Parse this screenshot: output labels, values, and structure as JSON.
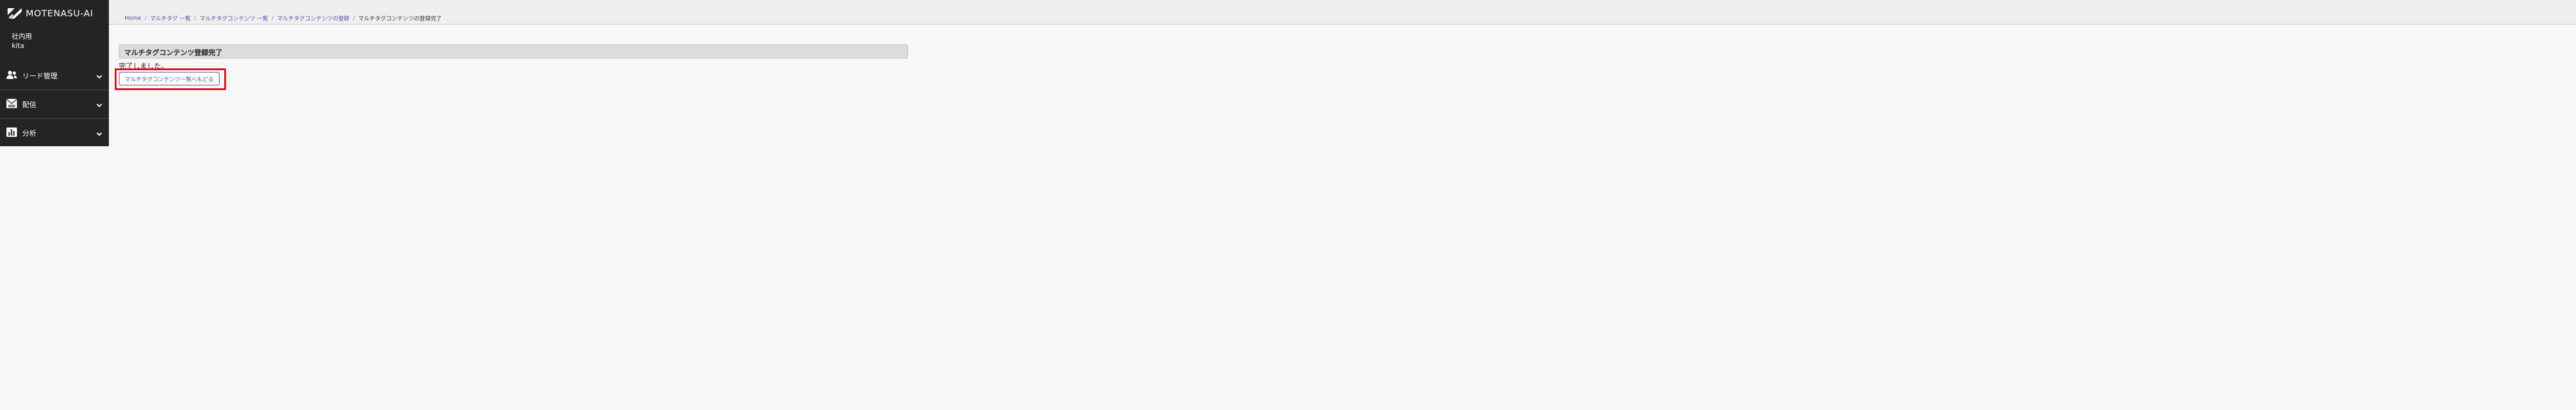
{
  "brand": {
    "name": "MOTENASU-AI"
  },
  "user": {
    "org": "社内用",
    "name": "kita"
  },
  "nav": {
    "items": [
      {
        "label": "リード管理",
        "icon": "users-icon"
      },
      {
        "label": "配信",
        "icon": "mail-icon"
      },
      {
        "label": "分析",
        "icon": "bar-chart-icon"
      }
    ]
  },
  "breadcrumb": {
    "items": [
      "Home",
      "マルチタグ 一覧",
      "マルチタグコンテンツ 一覧",
      "マルチタグコンテンツの登録"
    ],
    "current": "マルチタグコンテンツの登録完了",
    "separator": "/"
  },
  "main": {
    "section_title": "マルチタグコンテンツ登録完了",
    "message": "完了しました。",
    "back_button_label": "マルチタグコンテンツ一覧へもどる"
  },
  "colors": {
    "sidebar_bg": "#242424",
    "link": "#4b53a6",
    "highlight": "#e6001a"
  }
}
